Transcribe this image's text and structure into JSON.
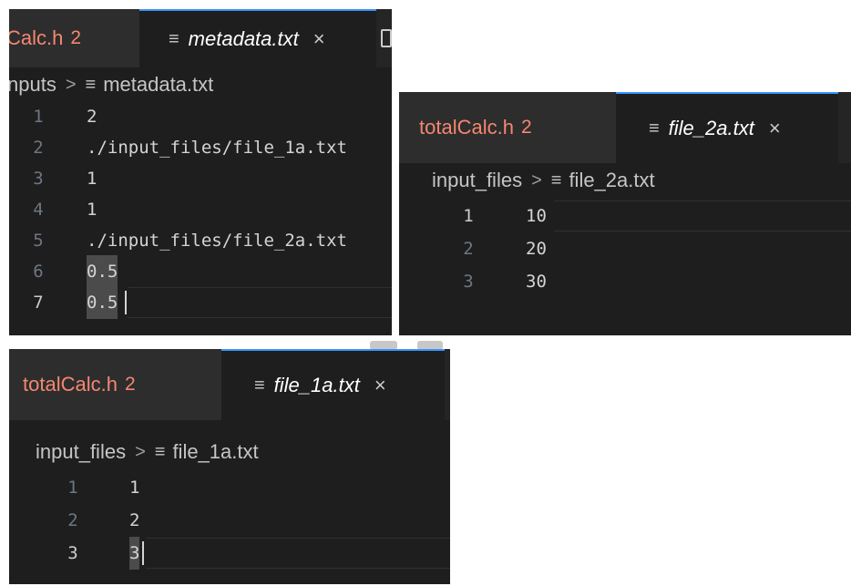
{
  "panel1": {
    "tab_inactive_name": "Calc.h",
    "tab_inactive_count": "2",
    "tab_active_icon": "≡",
    "tab_active_name": "metadata.txt",
    "tab_close": "×",
    "breadcrumb_folder": "nputs",
    "breadcrumb_sep": ">",
    "breadcrumb_icon": "≡",
    "breadcrumb_file": "metadata.txt",
    "lines": [
      {
        "num": "1",
        "text": "2"
      },
      {
        "num": "2",
        "text": "./input_files/file_1a.txt"
      },
      {
        "num": "3",
        "text": "1"
      },
      {
        "num": "4",
        "text": "1"
      },
      {
        "num": "5",
        "text": "./input_files/file_2a.txt"
      },
      {
        "num": "6",
        "text": "0.5"
      },
      {
        "num": "7",
        "text": "0.5"
      }
    ]
  },
  "panel2": {
    "tab_inactive_name": "totalCalc.h",
    "tab_inactive_count": "2",
    "tab_active_icon": "≡",
    "tab_active_name": "file_2a.txt",
    "tab_close": "×",
    "breadcrumb_folder": "input_files",
    "breadcrumb_sep": ">",
    "breadcrumb_icon": "≡",
    "breadcrumb_file": "file_2a.txt",
    "lines": [
      {
        "num": "1",
        "text": "10"
      },
      {
        "num": "2",
        "text": "20"
      },
      {
        "num": "3",
        "text": "30"
      }
    ]
  },
  "panel3": {
    "tab_inactive_name": "totalCalc.h",
    "tab_inactive_count": "2",
    "tab_active_icon": "≡",
    "tab_active_name": "file_1a.txt",
    "tab_close": "×",
    "breadcrumb_folder": "input_files",
    "breadcrumb_sep": ">",
    "breadcrumb_icon": "≡",
    "breadcrumb_file": "file_1a.txt",
    "lines": [
      {
        "num": "1",
        "text": "1"
      },
      {
        "num": "2",
        "text": "2"
      },
      {
        "num": "3",
        "text": "3"
      }
    ]
  },
  "colors": {
    "editor_bg": "#1e1e1e",
    "tab_active_border": "#3794ff",
    "error_tab_text": "#f48771",
    "selection": "#4b4b4b"
  },
  "icons": {
    "file_icon": "lines-icon",
    "close_icon": "close-icon",
    "split_icon": "split-editor-icon",
    "breadcrumb_sep": "chevron-right-icon"
  }
}
